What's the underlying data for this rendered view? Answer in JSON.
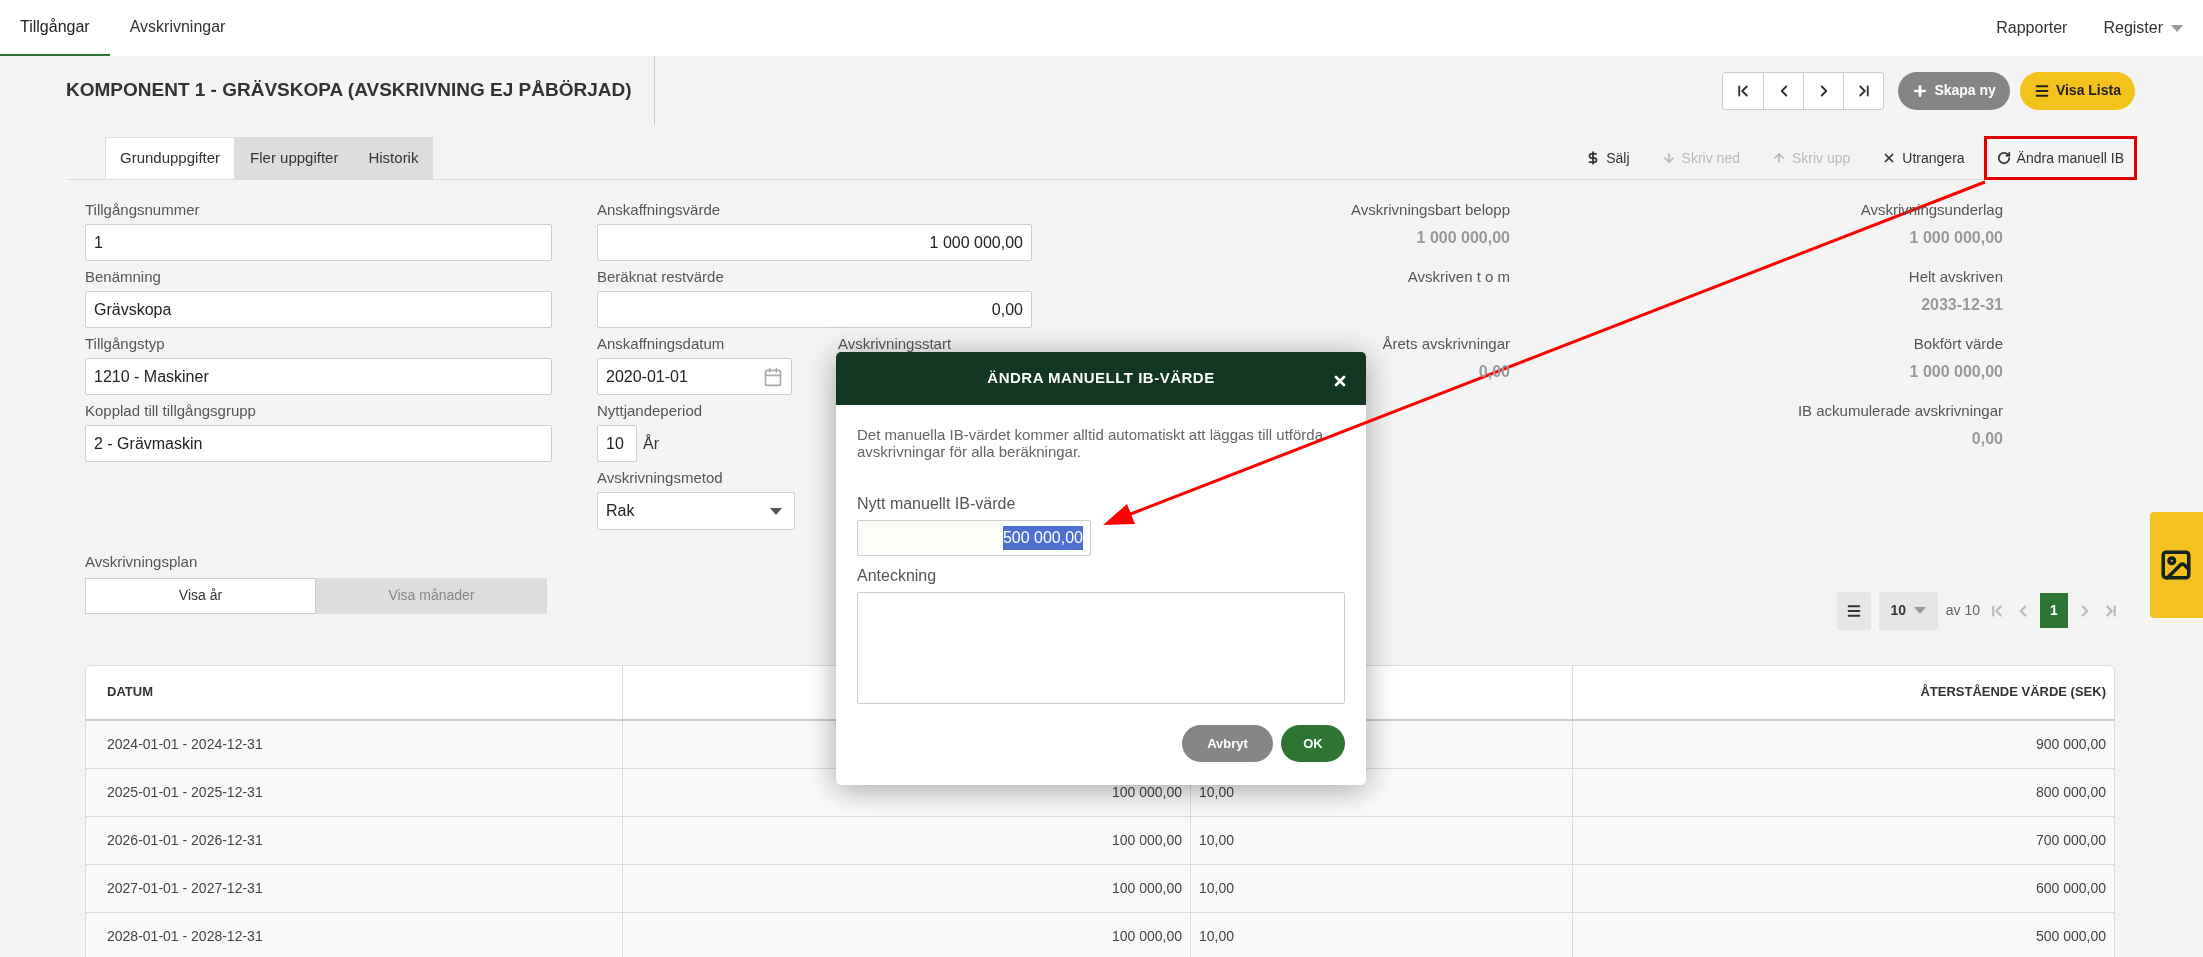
{
  "top_nav": {
    "tabs": [
      {
        "label": "Tillgångar",
        "selected": true
      },
      {
        "label": "Avskrivningar",
        "selected": false
      }
    ],
    "menu": [
      {
        "label": "Rapporter",
        "dropdown": false
      },
      {
        "label": "Register",
        "dropdown": true
      }
    ]
  },
  "header": {
    "title": "KOMPONENT 1 - GRÄVSKOPA (AVSKRIVNING EJ PÅBÖRJAD)",
    "buttons": [
      {
        "label": "Skapa ny",
        "kind": "create"
      },
      {
        "label": "Visa Lista",
        "kind": "list"
      }
    ]
  },
  "tabs": [
    {
      "label": "Grunduppgifter",
      "selected": true
    },
    {
      "label": "Fler uppgifter",
      "selected": false
    },
    {
      "label": "Historik",
      "selected": false
    }
  ],
  "actions": [
    {
      "label": "Sälj",
      "kind": "sell",
      "disabled": false,
      "highlighted": false
    },
    {
      "label": "Skriv ned",
      "kind": "down",
      "disabled": true,
      "highlighted": false
    },
    {
      "label": "Skriv upp",
      "kind": "up",
      "disabled": true,
      "highlighted": false
    },
    {
      "label": "Utrangera",
      "kind": "scrap",
      "disabled": false,
      "highlighted": false
    },
    {
      "label": "Ändra manuell IB",
      "kind": "reset",
      "disabled": false,
      "highlighted": true
    }
  ],
  "form": {
    "left_fields": [
      {
        "label": "Tillgångsnummer",
        "value": "1"
      },
      {
        "label": "Benämning",
        "value": "Grävskopa"
      },
      {
        "label": "Tillgångstyp",
        "value": "1210 - Maskiner"
      },
      {
        "label": "Kopplad till tillgångsgrupp",
        "value": "2 - Grävmaskin"
      }
    ],
    "middle_fields": [
      {
        "label": "Anskaffningsvärde",
        "value": "1 000 000,00",
        "kind": "number"
      },
      {
        "label": "Beräknat restvärde",
        "value": "0,00",
        "kind": "number"
      },
      {
        "label": "Anskaffningsdatum",
        "value": "2020-01-01",
        "kind": "date"
      },
      {
        "label": "Nyttjandeperiod",
        "value": "10",
        "unit": "År",
        "kind": "period"
      },
      {
        "label": "Avskrivningsmetod",
        "value": "Rak",
        "kind": "select"
      }
    ],
    "start_label": "Avskrivningsstart"
  },
  "summary": {
    "column_1": [
      {
        "label": "Avskrivningsbart belopp",
        "value": "1 000 000,00"
      },
      {
        "label": "Avskriven t o m"
      },
      {
        "label": "Årets avskrivningar",
        "value": "0,00"
      }
    ],
    "column_2": [
      {
        "label": "Avskrivningsunderlag",
        "value": "1 000 000,00"
      },
      {
        "label": "Helt avskriven",
        "value": "2033-12-31"
      },
      {
        "label": "Bokfört värde",
        "value": "1 000 000,00"
      },
      {
        "label": "IB ackumulerade avskrivningar",
        "value": "0,00"
      }
    ]
  },
  "plan": {
    "label": "Avskrivningsplan",
    "toggle": [
      {
        "label": "Visa år",
        "selected": true
      },
      {
        "label": "Visa månader",
        "selected": false
      }
    ]
  },
  "pagination": {
    "page_size": "10",
    "total": "av 10",
    "pages": [
      {
        "label": "1",
        "selected": true
      }
    ]
  },
  "table": {
    "columns": {
      "column_1": "DATUM",
      "column_4": "ÅTERSTÅENDE VÄRDE (SEK)"
    },
    "rows": [
      {
        "date": "2024-01-01 - 2024-12-31",
        "remaining": "900 000,00"
      },
      {
        "date": "2025-01-01 - 2025-12-31",
        "amount": "100 000,00",
        "rate": "10,00",
        "remaining": "800 000,00"
      },
      {
        "date": "2026-01-01 - 2026-12-31",
        "amount": "100 000,00",
        "rate": "10,00",
        "remaining": "700 000,00"
      },
      {
        "date": "2027-01-01 - 2027-12-31",
        "amount": "100 000,00",
        "rate": "10,00",
        "remaining": "600 000,00"
      },
      {
        "date": "2028-01-01 - 2028-12-31",
        "amount": "100 000,00",
        "rate": "10,00",
        "remaining": "500 000,00"
      }
    ]
  },
  "dialog": {
    "title": "ÄNDRA MANUELLT IB-VÄRDE",
    "message": "Det manuella IB-värdet kommer alltid automatiskt att läggas till utförda avskrivningar för alla beräkningar.",
    "fields": [
      {
        "label": "Nytt manuellt IB-värde",
        "value": "500 000,00",
        "kind": "input",
        "text_selected": true
      },
      {
        "label": "Anteckning",
        "kind": "textarea"
      }
    ],
    "buttons": [
      {
        "label": "Avbryt",
        "kind": "secondary"
      },
      {
        "label": "OK",
        "kind": "primary"
      }
    ]
  }
}
